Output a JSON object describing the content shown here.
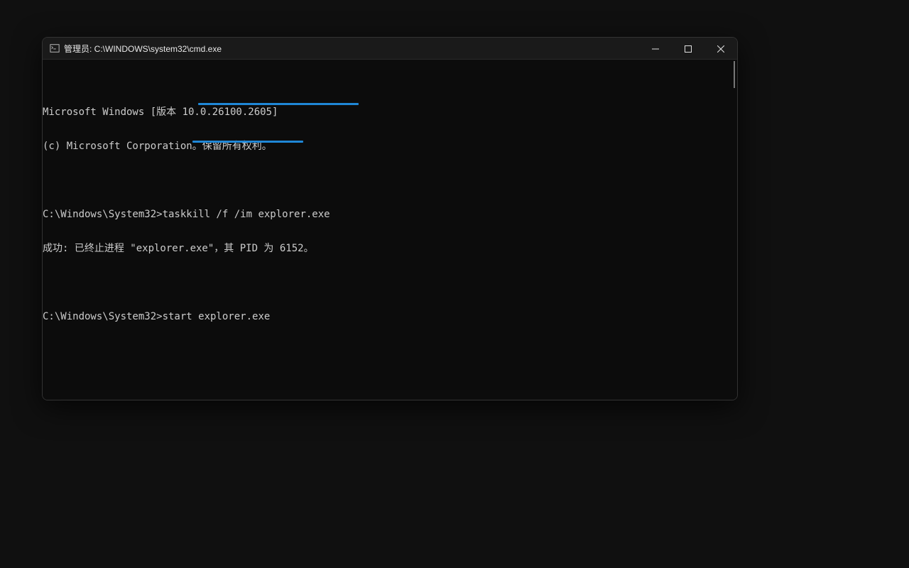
{
  "window": {
    "title": "管理员: C:\\WINDOWS\\system32\\cmd.exe"
  },
  "terminal": {
    "line1": "Microsoft Windows [版本 10.0.26100.2605]",
    "line2": "(c) Microsoft Corporation。保留所有权利。",
    "prompt1": "C:\\Windows\\System32>",
    "command1": "taskkill /f /im explorer.exe",
    "result1": "成功: 已终止进程 \"explorer.exe\"，其 PID 为 6152。",
    "prompt2": "C:\\Windows\\System32>",
    "command2": "start explorer.exe"
  }
}
